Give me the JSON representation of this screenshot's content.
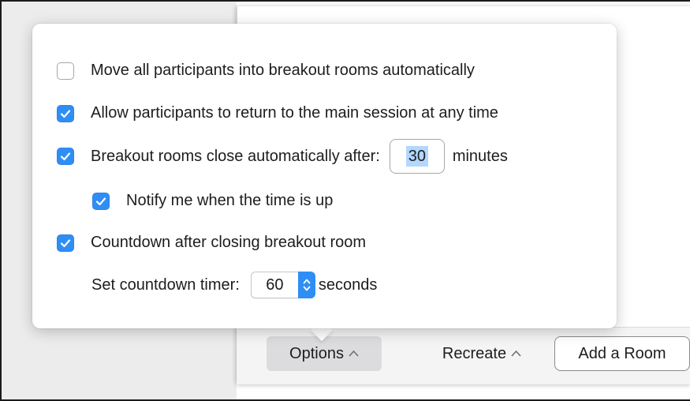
{
  "options": {
    "move_all": {
      "label": "Move all participants into breakout rooms automatically",
      "checked": false
    },
    "allow_return": {
      "label": "Allow participants to return to the main session at any time",
      "checked": true
    },
    "auto_close": {
      "label": "Breakout rooms close automatically after:",
      "checked": true,
      "minutes_value": "30",
      "unit_label": "minutes"
    },
    "notify": {
      "label": "Notify me when the time is up",
      "checked": true
    },
    "countdown": {
      "label": "Countdown after closing breakout room",
      "checked": true
    },
    "countdown_timer": {
      "label": "Set countdown timer:",
      "value": "60",
      "unit_label": "seconds"
    }
  },
  "toolbar": {
    "options_label": "Options",
    "recreate_label": "Recreate",
    "add_room_label": "Add a Room"
  },
  "icons": {
    "checkbox_checked": "checkmark-icon",
    "caret": "chevron-up-icon",
    "stepper": "up-down-stepper-icon"
  },
  "colors": {
    "accent": "#2f8ef5",
    "selection": "#b3d7ff"
  }
}
